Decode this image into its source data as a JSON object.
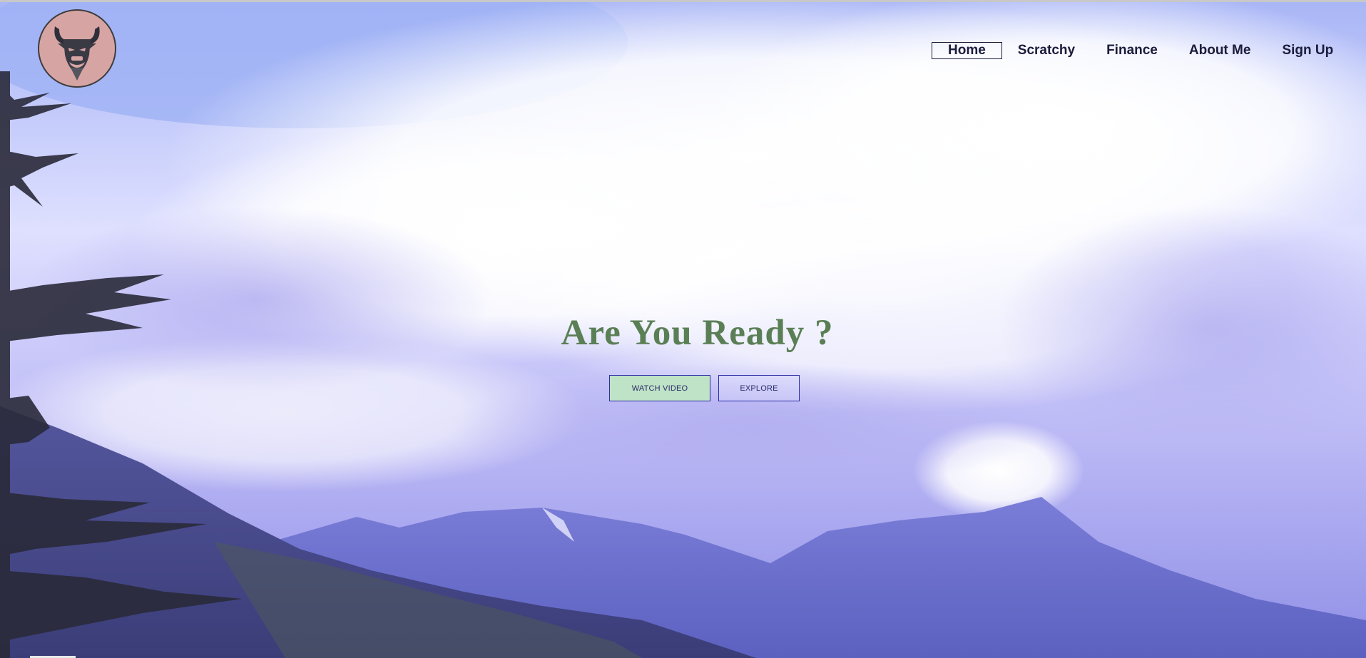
{
  "header": {
    "logo_icon": "bull-skull-icon",
    "nav": [
      {
        "label": "Home",
        "active": true
      },
      {
        "label": "Scratchy",
        "active": false
      },
      {
        "label": "Finance",
        "active": false
      },
      {
        "label": "About Me",
        "active": false
      },
      {
        "label": "Sign Up",
        "active": false
      }
    ]
  },
  "hero": {
    "title": "Are You Ready ?",
    "buttons": {
      "watch_video": "WATCH VIDEO",
      "explore": "EXPLORE"
    }
  },
  "colors": {
    "title": "#5a7f55",
    "nav_text": "#1c1c3c",
    "watch_button_bg": "#bfe3c6",
    "button_border": "#2c2ca8",
    "logo_bg": "#d7a4a4"
  }
}
